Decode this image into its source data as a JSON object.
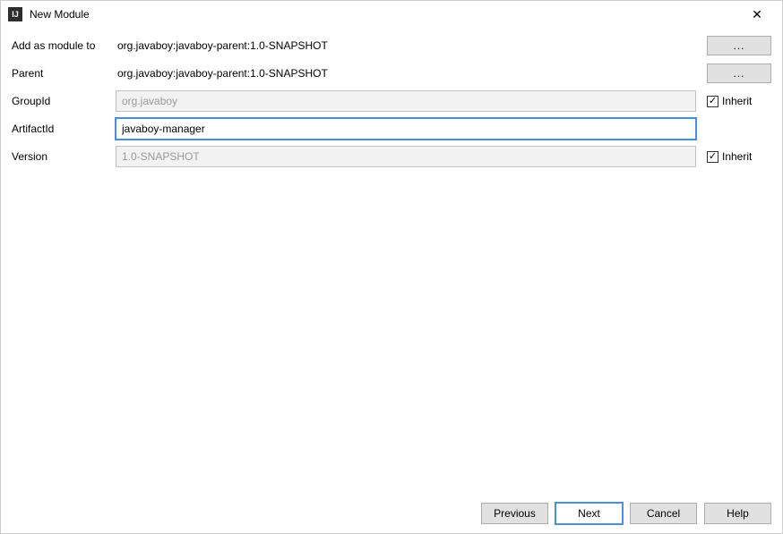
{
  "titlebar": {
    "icon_label": "IJ",
    "title": "New Module",
    "close_glyph": "✕"
  },
  "form": {
    "add_module_label": "Add as module to",
    "add_module_value": "org.javaboy:javaboy-parent:1.0-SNAPSHOT",
    "parent_label": "Parent",
    "parent_value": "org.javaboy:javaboy-parent:1.0-SNAPSHOT",
    "group_id_label": "GroupId",
    "group_id_value": "org.javaboy",
    "artifact_id_label": "ArtifactId",
    "artifact_id_value": "javaboy-manager",
    "version_label": "Version",
    "version_value": "1.0-SNAPSHOT",
    "browse_label": "...",
    "inherit_label": "Inherit",
    "group_id_inherit_checked": true,
    "version_inherit_checked": true
  },
  "footer": {
    "previous": "Previous",
    "next": "Next",
    "cancel": "Cancel",
    "help": "Help"
  }
}
